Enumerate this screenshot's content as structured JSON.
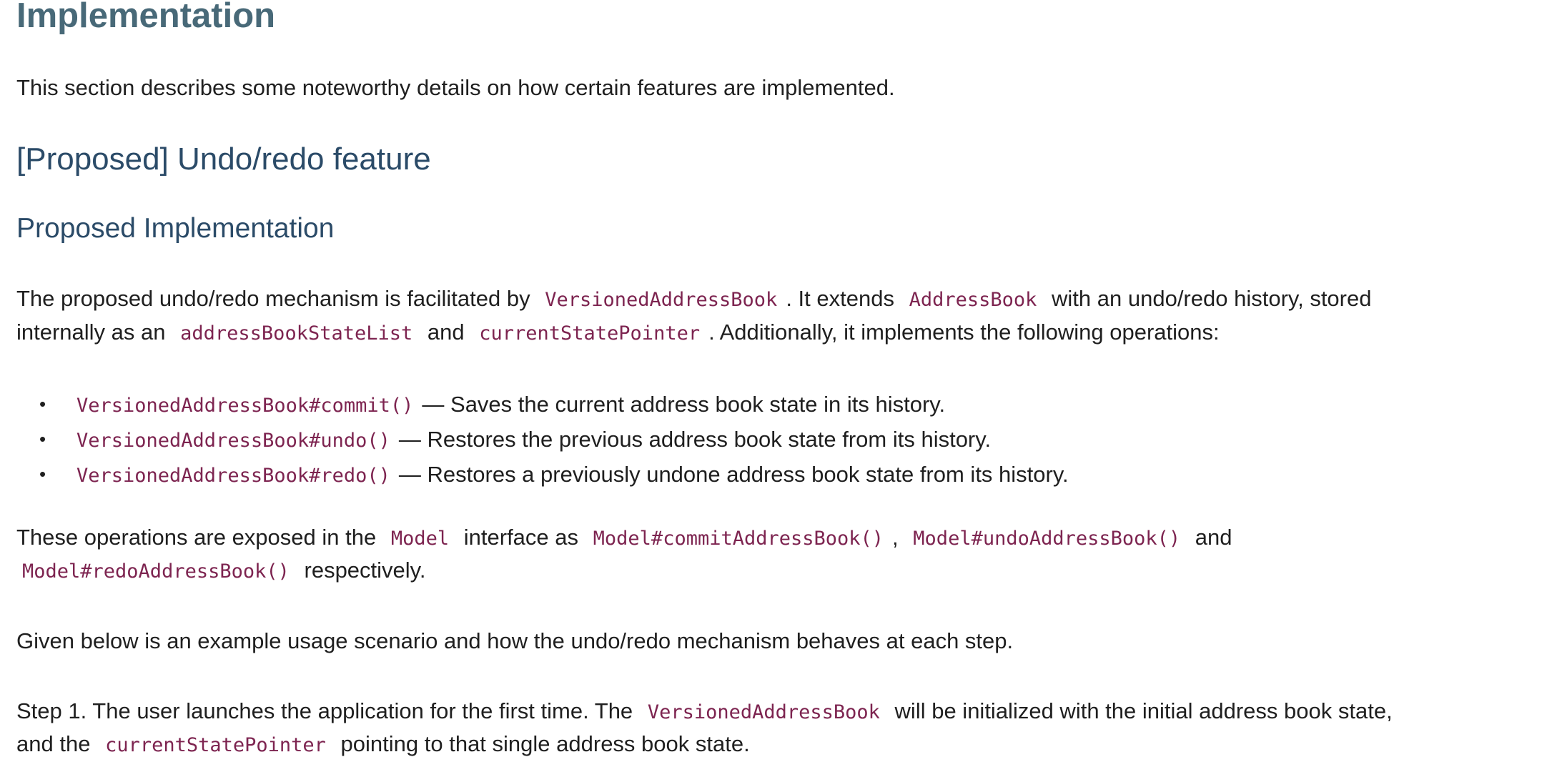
{
  "heading": "Implementation",
  "intro": "This section describes some noteworthy details on how certain features are implemented.",
  "section_title": "[Proposed] Undo/redo feature",
  "subsection_title": "Proposed Implementation",
  "para1": {
    "t1": "The proposed undo/redo mechanism is facilitated by",
    "c1": "VersionedAddressBook",
    "t2": ". It extends",
    "c2": "AddressBook",
    "t3": "with an undo/redo history, stored",
    "t4": "internally as an",
    "c3": "addressBookStateList",
    "t5": "and",
    "c4": "currentStatePointer",
    "t6": ". Additionally, it implements the following operations:"
  },
  "operations": [
    {
      "code": "VersionedAddressBook#commit()",
      "desc": "— Saves the current address book state in its history."
    },
    {
      "code": "VersionedAddressBook#undo()",
      "desc": "— Restores the previous address book state from its history."
    },
    {
      "code": "VersionedAddressBook#redo()",
      "desc": "— Restores a previously undone address book state from its history."
    }
  ],
  "bullet_glyph": "•",
  "para2": {
    "t1": "These operations are exposed in the",
    "c1": "Model",
    "t2": "interface as",
    "c2": "Model#commitAddressBook()",
    "t3": ",",
    "c3": "Model#undoAddressBook()",
    "t4": "and",
    "c4": "Model#redoAddressBook()",
    "t5": "respectively."
  },
  "para3": "Given below is an example usage scenario and how the undo/redo mechanism behaves at each step.",
  "para4": {
    "t1": "Step 1. The user launches the application for the first time. The",
    "c1": "VersionedAddressBook",
    "t2": "will be initialized with the initial address book state,",
    "t3": "and the",
    "c2": "currentStatePointer",
    "t4": "pointing to that single address book state."
  }
}
